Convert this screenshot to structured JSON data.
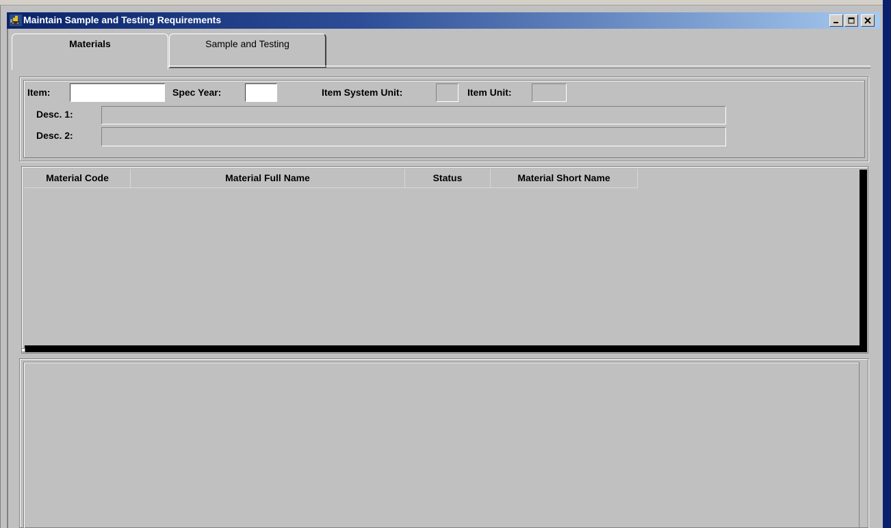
{
  "window": {
    "title": "Maintain Sample and Testing Requirements",
    "controls": {
      "minimize": "_",
      "maximize": "□",
      "close": "×"
    }
  },
  "tabs": [
    {
      "label": "Materials",
      "active": true
    },
    {
      "label": "Sample and Testing",
      "active": false
    }
  ],
  "item_section": {
    "item_label": "Item:",
    "item_value": "",
    "spec_year_label": "Spec Year:",
    "spec_year_value": "",
    "item_system_unit_label": "Item System Unit:",
    "item_system_unit_value": "",
    "item_unit_label": "Item Unit:",
    "item_unit_value": "",
    "desc1_label": "Desc. 1:",
    "desc1_value": "",
    "desc2_label": "Desc. 2:",
    "desc2_value": ""
  },
  "materials_grid": {
    "columns": [
      "Material Code",
      "Material Full Name",
      "Status",
      "Material Short Name"
    ],
    "rows": []
  },
  "icons": {
    "app_icon": "bulldozer-icon"
  },
  "colors": {
    "titlebar_start": "#0a246a",
    "titlebar_end": "#a6caf0",
    "window_bg": "#c0c0c0"
  }
}
